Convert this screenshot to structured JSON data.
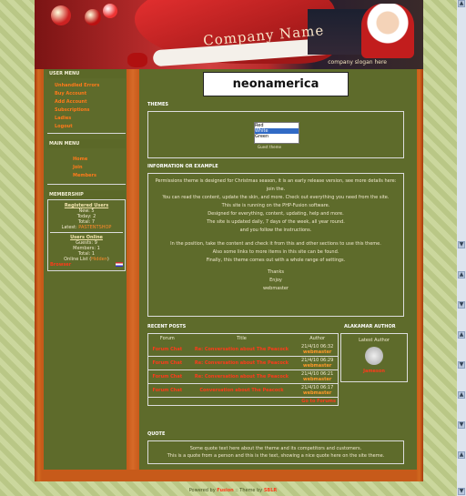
{
  "header": {
    "company": "Company Name",
    "slogan": "company slogan here"
  },
  "sponsor": {
    "logo_text": "neonamerica"
  },
  "user_menu": {
    "title": "USER MENU",
    "items": [
      "Unhandled Errors",
      "Buy Account",
      "Add Account",
      "Subscriptions",
      "Ladies",
      "Logout"
    ]
  },
  "main_menu": {
    "title": "MAIN MENU",
    "items": [
      "Home",
      "Join",
      "Members"
    ]
  },
  "membership": {
    "title": "MEMBERSHIP",
    "registered_title": "Registered Users",
    "registered": [
      "New: 5",
      "Today: 2",
      "Total: 7"
    ],
    "latest_label": "Latest:",
    "latest_user": "PASTENTSHOP",
    "online_title": "Users Online",
    "online": [
      "Guests: 9",
      "Members: 1",
      "Total: 1"
    ],
    "online_list_label": "Online List",
    "online_list_link": "Hidden",
    "browser": "Browser"
  },
  "themes": {
    "title": "THEMES",
    "options": [
      "Red",
      "White",
      "Green"
    ],
    "note": "Guest theme"
  },
  "info": {
    "title": "INFORMATION OR EXAMPLE",
    "lines": [
      "Permissions theme is designed for Christmas season, it is an early release version, see more details here: join the.",
      "You can read the content, update the skin, and more. Check out everything you need from the site.",
      "This site is running on the PHP-Fusion software.",
      "Designed for everything, content, updating, help and more.",
      "The site is updated daily, 7 days of the week, all year round.",
      "and you follow the instructions."
    ],
    "lines2": [
      "In the position, take the content and check it from this and other sections to use this theme.",
      "Also some links to more items in this site can be found.",
      "Finally, this theme comes out with a whole range of settings."
    ],
    "closing": [
      "Thanks",
      "Enjoy",
      "webmaster"
    ]
  },
  "recent": {
    "title": "RECENT POSTS",
    "headers": [
      "Forum",
      "Title",
      "Author"
    ],
    "rows": [
      {
        "forum": "Forum Chat",
        "title": "Re: Conversation about The Peacock",
        "author_date": "21/4/10 06:32",
        "author": "webmaster"
      },
      {
        "forum": "Forum Chat",
        "title": "Re: Conversation about The Peacock",
        "author_date": "21/4/10 06:29",
        "author": "webmaster"
      },
      {
        "forum": "Forum Chat",
        "title": "Re: Conversation about The Peacock",
        "author_date": "21/4/10 06:21",
        "author": "webmaster"
      },
      {
        "forum": "Forum Chat",
        "title": "Conversation about The Peacock",
        "author_date": "21/4/10 06:17",
        "author": "webmaster"
      }
    ],
    "more": "Go to Forums"
  },
  "author_box": {
    "title": "ALAKAMAR AUTHOR",
    "name": "Latest Author",
    "link": "Jameson"
  },
  "quote": {
    "title": "QUOTE",
    "lines": [
      "Some quote text here about the theme and its competitors and customers.",
      "This is a quote from a person and this is the text, showing a nice quote here on the site theme."
    ]
  },
  "footer": {
    "powered_prefix": "Powered by",
    "powered_by": "Fusion",
    "separator": "::",
    "theme_prefix": "Theme by",
    "theme_by": "SBLR"
  },
  "colors": {
    "accent": "#ff7a1a",
    "panel": "#5e6b2b",
    "frame": "#c75a1a"
  }
}
